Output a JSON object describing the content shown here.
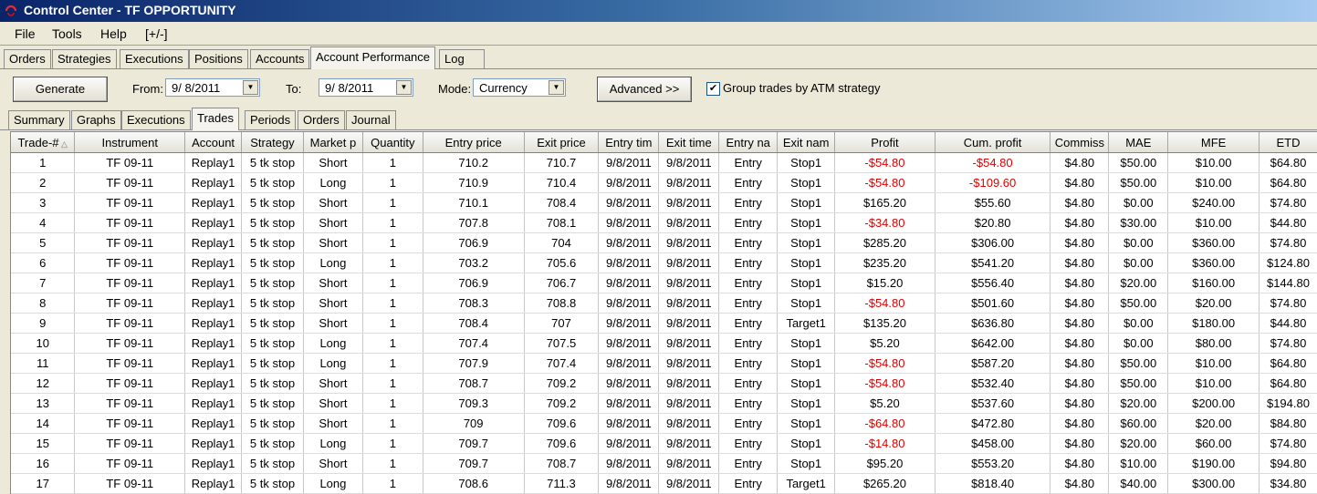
{
  "window": {
    "title": "Control Center - TF OPPORTUNITY"
  },
  "menu": {
    "items": [
      "File",
      "Tools",
      "Help",
      "[+/-]"
    ]
  },
  "main_tabs": [
    "Orders",
    "Strategies",
    "Executions",
    "Positions",
    "Accounts",
    "Account Performance",
    "Log"
  ],
  "main_tab_active": "Account Performance",
  "controls": {
    "generate_label": "Generate",
    "from_label": "From:",
    "from_value": "9/  8/2011",
    "to_label": "To:",
    "to_value": "9/  8/2011",
    "mode_label": "Mode:",
    "mode_value": "Currency",
    "advanced_label": "Advanced >>",
    "group_label": "Group trades by ATM strategy",
    "group_checked": true
  },
  "sub_tabs": [
    "Summary",
    "Graphs",
    "Executions",
    "Trades",
    "Periods",
    "Orders",
    "Journal"
  ],
  "sub_tab_active": "Trades",
  "table": {
    "columns": [
      "Trade-#",
      "Instrument",
      "Account",
      "Strategy",
      "Market p",
      "Quantity",
      "Entry price",
      "Exit price",
      "Entry tim",
      "Exit time",
      "Entry na",
      "Exit nam",
      "Profit",
      "Cum. profit",
      "Commiss",
      "MAE",
      "MFE",
      "ETD"
    ],
    "rows": [
      [
        "1",
        "TF 09-11",
        "Replay1",
        "5 tk stop",
        "Short",
        "1",
        "710.2",
        "710.7",
        "9/8/2011",
        "9/8/2011",
        "Entry",
        "Stop1",
        "-$54.80",
        "-$54.80",
        "$4.80",
        "$50.00",
        "$10.00",
        "$64.80"
      ],
      [
        "2",
        "TF 09-11",
        "Replay1",
        "5 tk stop",
        "Long",
        "1",
        "710.9",
        "710.4",
        "9/8/2011",
        "9/8/2011",
        "Entry",
        "Stop1",
        "-$54.80",
        "-$109.60",
        "$4.80",
        "$50.00",
        "$10.00",
        "$64.80"
      ],
      [
        "3",
        "TF 09-11",
        "Replay1",
        "5 tk stop",
        "Short",
        "1",
        "710.1",
        "708.4",
        "9/8/2011",
        "9/8/2011",
        "Entry",
        "Stop1",
        "$165.20",
        "$55.60",
        "$4.80",
        "$0.00",
        "$240.00",
        "$74.80"
      ],
      [
        "4",
        "TF 09-11",
        "Replay1",
        "5 tk stop",
        "Short",
        "1",
        "707.8",
        "708.1",
        "9/8/2011",
        "9/8/2011",
        "Entry",
        "Stop1",
        "-$34.80",
        "$20.80",
        "$4.80",
        "$30.00",
        "$10.00",
        "$44.80"
      ],
      [
        "5",
        "TF 09-11",
        "Replay1",
        "5 tk stop",
        "Short",
        "1",
        "706.9",
        "704",
        "9/8/2011",
        "9/8/2011",
        "Entry",
        "Stop1",
        "$285.20",
        "$306.00",
        "$4.80",
        "$0.00",
        "$360.00",
        "$74.80"
      ],
      [
        "6",
        "TF 09-11",
        "Replay1",
        "5 tk stop",
        "Long",
        "1",
        "703.2",
        "705.6",
        "9/8/2011",
        "9/8/2011",
        "Entry",
        "Stop1",
        "$235.20",
        "$541.20",
        "$4.80",
        "$0.00",
        "$360.00",
        "$124.80"
      ],
      [
        "7",
        "TF 09-11",
        "Replay1",
        "5 tk stop",
        "Short",
        "1",
        "706.9",
        "706.7",
        "9/8/2011",
        "9/8/2011",
        "Entry",
        "Stop1",
        "$15.20",
        "$556.40",
        "$4.80",
        "$20.00",
        "$160.00",
        "$144.80"
      ],
      [
        "8",
        "TF 09-11",
        "Replay1",
        "5 tk stop",
        "Short",
        "1",
        "708.3",
        "708.8",
        "9/8/2011",
        "9/8/2011",
        "Entry",
        "Stop1",
        "-$54.80",
        "$501.60",
        "$4.80",
        "$50.00",
        "$20.00",
        "$74.80"
      ],
      [
        "9",
        "TF 09-11",
        "Replay1",
        "5 tk stop",
        "Short",
        "1",
        "708.4",
        "707",
        "9/8/2011",
        "9/8/2011",
        "Entry",
        "Target1",
        "$135.20",
        "$636.80",
        "$4.80",
        "$0.00",
        "$180.00",
        "$44.80"
      ],
      [
        "10",
        "TF 09-11",
        "Replay1",
        "5 tk stop",
        "Long",
        "1",
        "707.4",
        "707.5",
        "9/8/2011",
        "9/8/2011",
        "Entry",
        "Stop1",
        "$5.20",
        "$642.00",
        "$4.80",
        "$0.00",
        "$80.00",
        "$74.80"
      ],
      [
        "11",
        "TF 09-11",
        "Replay1",
        "5 tk stop",
        "Long",
        "1",
        "707.9",
        "707.4",
        "9/8/2011",
        "9/8/2011",
        "Entry",
        "Stop1",
        "-$54.80",
        "$587.20",
        "$4.80",
        "$50.00",
        "$10.00",
        "$64.80"
      ],
      [
        "12",
        "TF 09-11",
        "Replay1",
        "5 tk stop",
        "Short",
        "1",
        "708.7",
        "709.2",
        "9/8/2011",
        "9/8/2011",
        "Entry",
        "Stop1",
        "-$54.80",
        "$532.40",
        "$4.80",
        "$50.00",
        "$10.00",
        "$64.80"
      ],
      [
        "13",
        "TF 09-11",
        "Replay1",
        "5 tk stop",
        "Short",
        "1",
        "709.3",
        "709.2",
        "9/8/2011",
        "9/8/2011",
        "Entry",
        "Stop1",
        "$5.20",
        "$537.60",
        "$4.80",
        "$20.00",
        "$200.00",
        "$194.80"
      ],
      [
        "14",
        "TF 09-11",
        "Replay1",
        "5 tk stop",
        "Short",
        "1",
        "709",
        "709.6",
        "9/8/2011",
        "9/8/2011",
        "Entry",
        "Stop1",
        "-$64.80",
        "$472.80",
        "$4.80",
        "$60.00",
        "$20.00",
        "$84.80"
      ],
      [
        "15",
        "TF 09-11",
        "Replay1",
        "5 tk stop",
        "Long",
        "1",
        "709.7",
        "709.6",
        "9/8/2011",
        "9/8/2011",
        "Entry",
        "Stop1",
        "-$14.80",
        "$458.00",
        "$4.80",
        "$20.00",
        "$60.00",
        "$74.80"
      ],
      [
        "16",
        "TF 09-11",
        "Replay1",
        "5 tk stop",
        "Short",
        "1",
        "709.7",
        "708.7",
        "9/8/2011",
        "9/8/2011",
        "Entry",
        "Stop1",
        "$95.20",
        "$553.20",
        "$4.80",
        "$10.00",
        "$190.00",
        "$94.80"
      ],
      [
        "17",
        "TF 09-11",
        "Replay1",
        "5 tk stop",
        "Long",
        "1",
        "708.6",
        "711.3",
        "9/8/2011",
        "9/8/2011",
        "Entry",
        "Target1",
        "$265.20",
        "$818.40",
        "$4.80",
        "$40.00",
        "$300.00",
        "$34.80"
      ]
    ]
  },
  "colors": {
    "negative": "#e00000",
    "titlebar_start": "#0a246a",
    "titlebar_end": "#a6caf0"
  }
}
